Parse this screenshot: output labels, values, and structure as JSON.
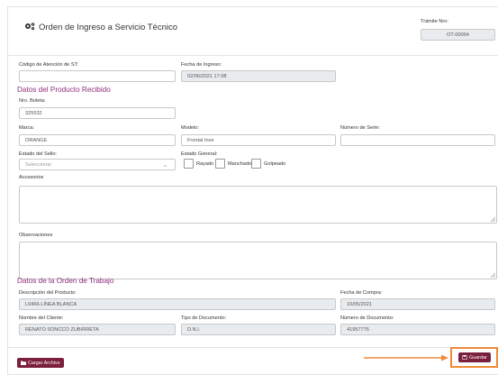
{
  "header": {
    "title": "Orden de Ingreso a Servicio Técnico",
    "tramite_label": "Trámite Nro:",
    "tramite_value": "OT-00064"
  },
  "general": {
    "codigo_label": "Código de Atención de ST:",
    "codigo_value": "",
    "fecha_label": "Fecha de Ingreso:",
    "fecha_value": "02/06/2021 17:08"
  },
  "producto": {
    "section_title": "Datos del Producto Recibido",
    "boleta_label": "Nro. Boleta:",
    "boleta_value": "325532",
    "marca_label": "Marca:",
    "marca_value": "ORANGE",
    "modelo_label": "Modelo:",
    "modelo_value": "Frontal Inox",
    "serie_label": "Número de Serie:",
    "serie_value": "",
    "sello_label": "Estado del Sello:",
    "sello_selected": "Seleccionar",
    "general_label": "Estado General:",
    "checkboxes": [
      "Rayado",
      "Manchado",
      "Golpeado"
    ],
    "accesorios_label": "Accesorios",
    "observaciones_label": "Observaciones"
  },
  "trabajo": {
    "section_title": "Datos de la Orden de Trabajo",
    "descripcion_label": "Descripción del Producto:",
    "descripcion_value": "L0466-LÍNEA BLANCA",
    "compra_label": "Fecha de Compra:",
    "compra_value": "10/05/2021",
    "cliente_label": "Nombre del Cliente:",
    "cliente_value": "RENATO SONCCO ZUBIRRETA",
    "tipo_doc_label": "Tipo de Documento:",
    "tipo_doc_value": "D.N.I.",
    "num_doc_label": "Número de Documento:",
    "num_doc_value": "41957775"
  },
  "actions": {
    "cargar_label": "Cargar Archivo",
    "guardar_label": "Guardar"
  },
  "colors": {
    "accent": "#8e2e7d",
    "button": "#7b1f3c",
    "highlight": "#f08a3a"
  }
}
